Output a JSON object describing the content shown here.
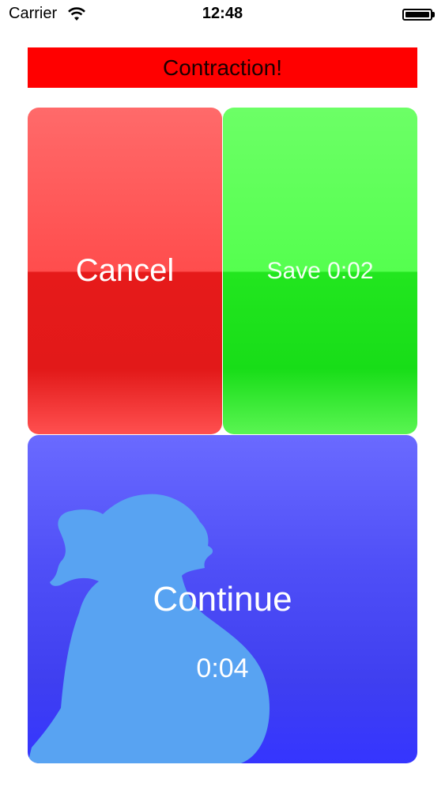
{
  "status_bar": {
    "carrier": "Carrier",
    "time": "12:48",
    "wifi_icon": "wifi-icon",
    "battery_icon": "battery-icon"
  },
  "banner": {
    "text": "Contraction!",
    "color": "#ff0000"
  },
  "buttons": {
    "cancel": {
      "label": "Cancel",
      "color": "#ee2b2b"
    },
    "save": {
      "label": "Save 0:02",
      "color": "#2de62a"
    },
    "continue": {
      "label": "Continue",
      "timer": "0:04",
      "color": "#4646f5"
    }
  },
  "decor": {
    "silhouette_icon": "pregnant-woman-silhouette-icon",
    "silhouette_color": "#58a3f2"
  }
}
